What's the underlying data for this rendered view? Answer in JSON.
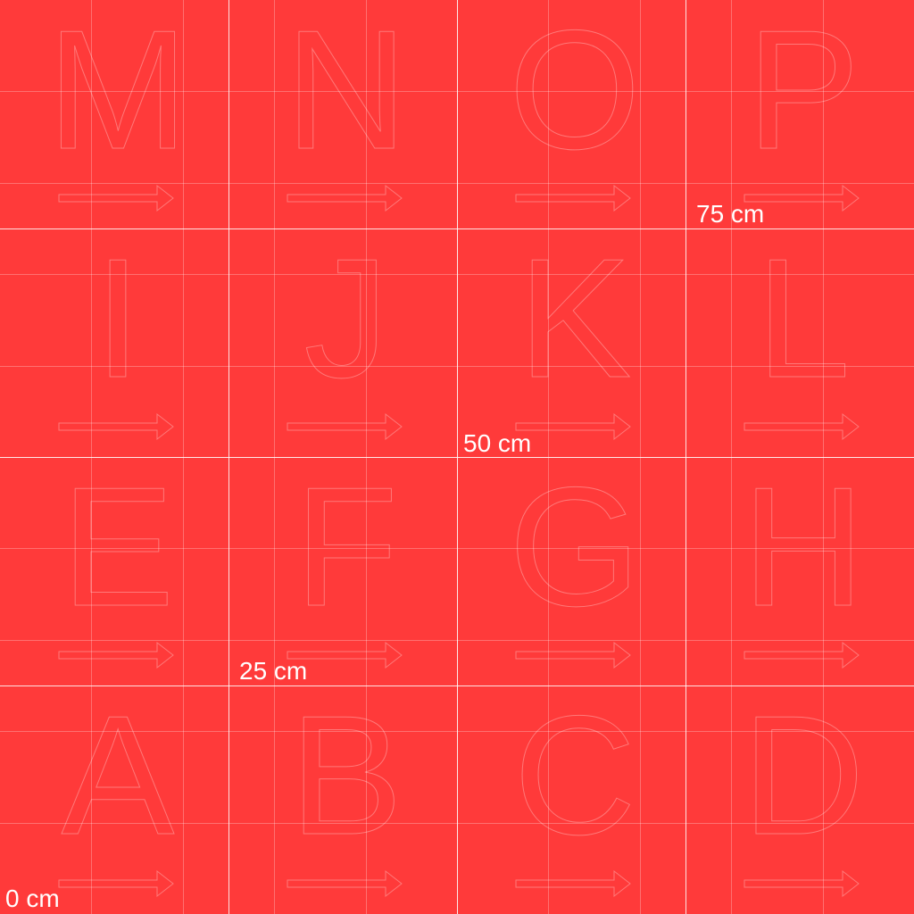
{
  "texture": {
    "background_color": "#ff3a3a",
    "line_color": "#ffffff",
    "rows": [
      [
        "M",
        "N",
        "O",
        "P"
      ],
      [
        "I",
        "J",
        "K",
        "L"
      ],
      [
        "E",
        "F",
        "G",
        "H"
      ],
      [
        "A",
        "B",
        "C",
        "D"
      ]
    ],
    "arrow_icon": "arrow-right-icon"
  },
  "scale_labels": [
    "0 cm",
    "25 cm",
    "50 cm",
    "75 cm"
  ]
}
